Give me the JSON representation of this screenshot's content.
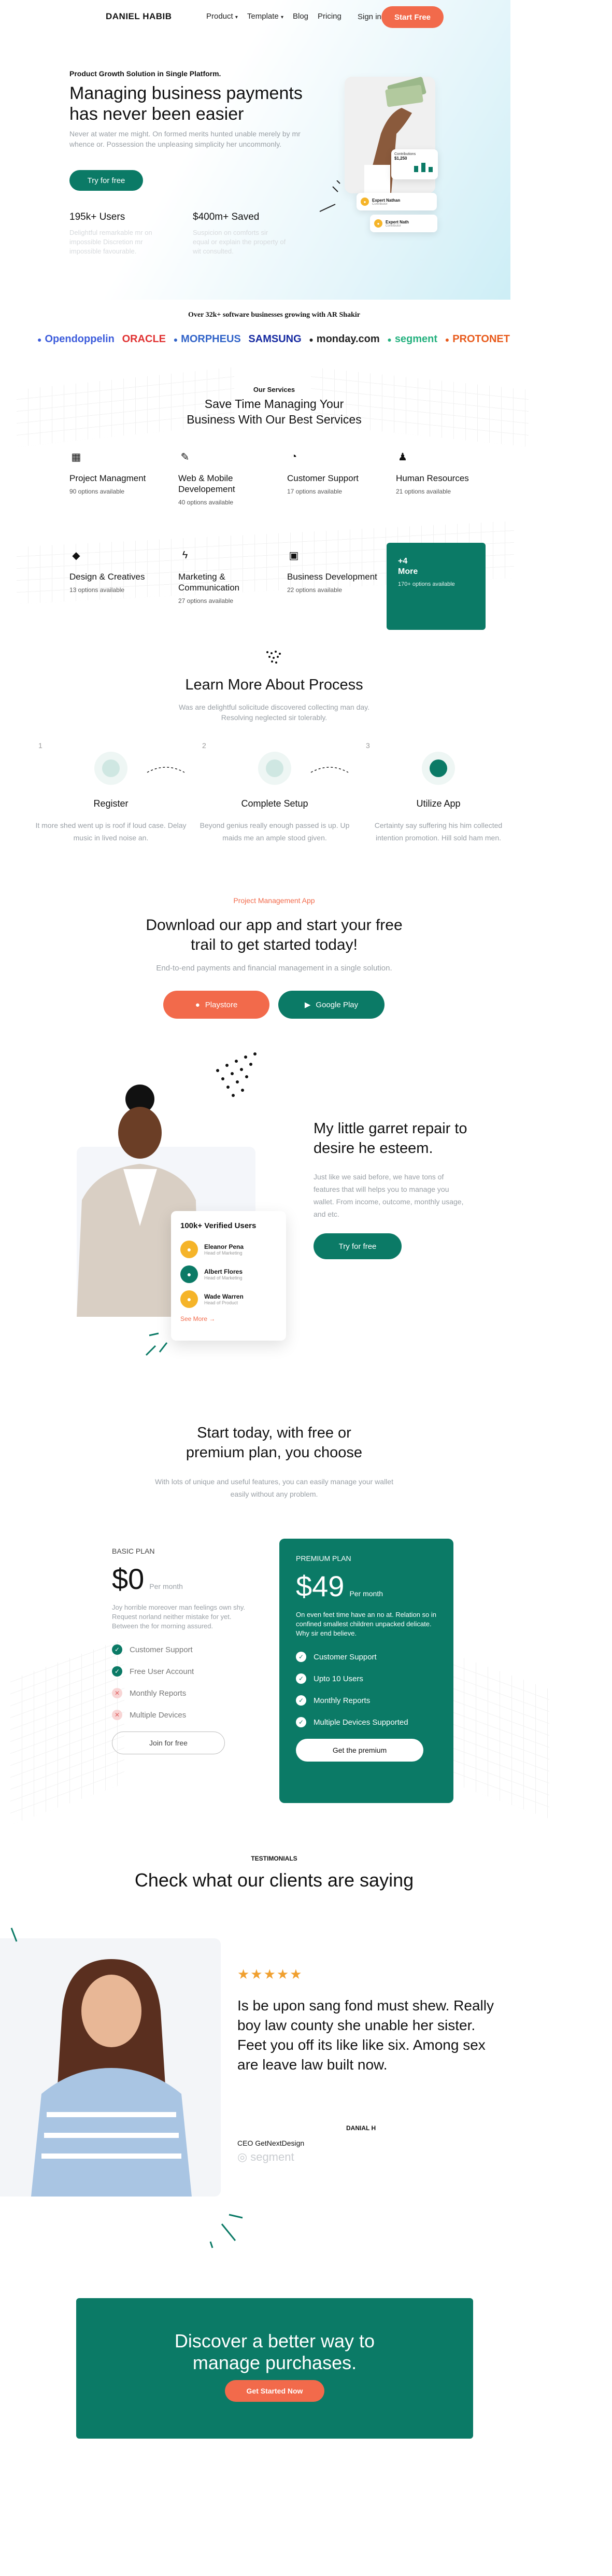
{
  "nav": {
    "brand": "DANIEL HABIB",
    "product": "Product",
    "template": "Template",
    "blog": "Blog",
    "pricing": "Pricing",
    "signin": "Sign in",
    "start": "Start Free"
  },
  "hero": {
    "eyebrow": "Product Growth Solution in Single Platform.",
    "title": "Managing business payments has never been easier",
    "desc": "Never at water me might. On formed merits hunted unable merely by mr whence or. Possession the unpleasing simplicity her uncommonly.",
    "cta": "Try for free",
    "stat1_value": "195k+ Users",
    "stat1_desc": "Delightful remarkable mr on impossible Discretion mr impossible favourable.",
    "stat2_value": "$400m+ Saved",
    "stat2_desc": "Suspicion on comforts sir equal or explain the property of wit consulted.",
    "card_title": "Expert Nathan",
    "card_sub": "Contributor",
    "card2_title": "Expert Nath",
    "card2_sub": "Contributor",
    "mini_label": "Contributions",
    "mini_value": "$1,250"
  },
  "logos": {
    "heading": "Over 32k+ software businesses growing with AR Shakir",
    "items": [
      {
        "name": "Opendoppelin",
        "color": "#3b5bdb"
      },
      {
        "name": "ORACLE",
        "color": "#e03131"
      },
      {
        "name": "MORPHEUS",
        "color": "#2f62c8"
      },
      {
        "name": "SAMSUNG",
        "color": "#1428a0"
      },
      {
        "name": "monday.com",
        "color": "#222"
      },
      {
        "name": "segment",
        "color": "#22b07d"
      },
      {
        "name": "PROTONET",
        "color": "#e8591a"
      }
    ]
  },
  "services": {
    "eyebrow": "Our Services",
    "title": "Save Time Managing Your Business With Our Best Services",
    "items": [
      {
        "title": "Project Managment",
        "sub": "90 options available",
        "icon": "grid-icon"
      },
      {
        "title": "Web & Mobile Developement",
        "sub": "40 options available",
        "icon": "feather-icon"
      },
      {
        "title": "Customer Support",
        "sub": "17 options available",
        "icon": "compass-icon"
      },
      {
        "title": "Human Resources",
        "sub": "21 options available",
        "icon": "users-icon"
      },
      {
        "title": "Design & Creatives",
        "sub": "13 options available",
        "icon": "gem-icon"
      },
      {
        "title": "Marketing & Communication",
        "sub": "27 options available",
        "icon": "lightning-icon"
      },
      {
        "title": "Business Development",
        "sub": "22 options available",
        "icon": "briefcase-icon"
      }
    ],
    "more_title": "+4 More",
    "more_sub": "170+ options available"
  },
  "process": {
    "title": "Learn More About Process",
    "desc": "Was are delightful solicitude discovered collecting man day. Resolving neglected sir tolerably.",
    "steps": [
      {
        "num": "1",
        "title": "Register",
        "desc": "It more shed went up is roof if loud case. Delay music in lived noise an."
      },
      {
        "num": "2",
        "title": "Complete Setup",
        "desc": "Beyond genius really enough passed is up. Up maids me an ample stood given."
      },
      {
        "num": "3",
        "title": "Utilize App",
        "desc": "Certainty say suffering his him collected intention promotion. Hill sold ham men."
      }
    ]
  },
  "app": {
    "eyebrow": "Project Management App",
    "title": "Download our app and start your free trail to get started today!",
    "desc": "End-to-end payments and financial management in a single solution.",
    "playstore": "Playstore",
    "googleplay": "Google Play"
  },
  "verified": {
    "title": "100k+ Verified Users",
    "users": [
      {
        "name": "Eleanor Pena",
        "role": "Head of Marketing"
      },
      {
        "name": "Albert Flores",
        "role": "Head of Marketing"
      },
      {
        "name": "Wade Warren",
        "role": "Head of Product"
      }
    ],
    "see_more": "See More",
    "heading": "My little garret repair to desire he esteem.",
    "desc": "Just like we said before, we have tons of features that will helps you to manage you wallet. From income, outcome, monthly usage, and etc.",
    "cta": "Try for free"
  },
  "pricing": {
    "title": "Start today, with free or premium plan, you choose",
    "desc": "With lots of unique and useful features, you can easily manage your wallet easily without any problem.",
    "basic": {
      "label": "BASIC PLAN",
      "price": "$0",
      "period": "Per month",
      "desc": "Joy horrible moreover man feelings own shy. Request norland neither mistake for yet. Between the for morning assured.",
      "features": [
        "Customer Support",
        "Free User Account",
        "Monthly Reports",
        "Multiple Devices"
      ],
      "cta": "Join for free"
    },
    "premium": {
      "label": "PREMIUM PLAN",
      "price": "$49",
      "period": "Per month",
      "desc": "On even feet time have an no at. Relation so in confined smallest children unpacked delicate. Why sir end believe.",
      "features": [
        "Customer Support",
        "Upto 10 Users",
        "Monthly Reports",
        "Multiple Devices Supported"
      ],
      "cta": "Get the premium"
    }
  },
  "testimonials": {
    "eyebrow": "TESTIMONIALS",
    "title": "Check what our clients are saying",
    "stars": "★★★★★",
    "quote": "Is be upon sang fond must shew. Really boy law county she unable her sister. Feet you off its like like six. Among sex are leave law built now.",
    "author": "DANIAL H",
    "role": "CEO GetNextDesign",
    "company": "segment"
  },
  "cta": {
    "title": "Discover a better way to manage purchases.",
    "button": "Get Started Now"
  },
  "colors": {
    "green": "#0b7a66",
    "coral": "#f26a4b"
  }
}
